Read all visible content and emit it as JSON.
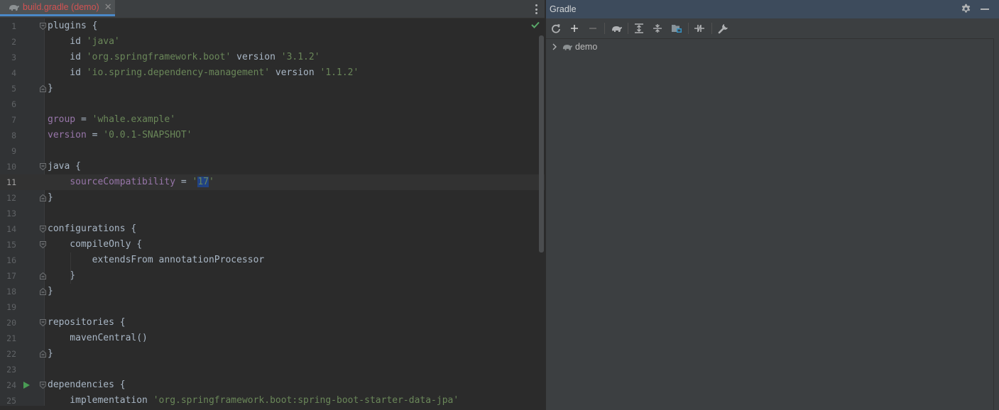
{
  "editor": {
    "tab": {
      "label": "build.gradle (demo)",
      "close": "✕"
    },
    "current_line": 11,
    "lines": [
      {
        "n": "1",
        "tokens": [
          {
            "t": "plugins {",
            "c": "plain"
          }
        ]
      },
      {
        "n": "2",
        "tokens": [
          {
            "t": "    id ",
            "c": "plain"
          },
          {
            "t": "'java'",
            "c": "str"
          }
        ]
      },
      {
        "n": "3",
        "tokens": [
          {
            "t": "    id ",
            "c": "plain"
          },
          {
            "t": "'org.springframework.boot'",
            "c": "str"
          },
          {
            "t": " version ",
            "c": "plain"
          },
          {
            "t": "'3.1.2'",
            "c": "str"
          }
        ]
      },
      {
        "n": "4",
        "tokens": [
          {
            "t": "    id ",
            "c": "plain"
          },
          {
            "t": "'io.spring.dependency-management'",
            "c": "str"
          },
          {
            "t": " version ",
            "c": "plain"
          },
          {
            "t": "'1.1.2'",
            "c": "str"
          }
        ]
      },
      {
        "n": "5",
        "tokens": [
          {
            "t": "}",
            "c": "plain"
          }
        ]
      },
      {
        "n": "6",
        "tokens": []
      },
      {
        "n": "7",
        "tokens": [
          {
            "t": "group",
            "c": "prop"
          },
          {
            "t": " = ",
            "c": "plain"
          },
          {
            "t": "'whale.example'",
            "c": "str"
          }
        ]
      },
      {
        "n": "8",
        "tokens": [
          {
            "t": "version",
            "c": "prop"
          },
          {
            "t": " = ",
            "c": "plain"
          },
          {
            "t": "'0.0.1-SNAPSHOT'",
            "c": "str"
          }
        ]
      },
      {
        "n": "9",
        "tokens": []
      },
      {
        "n": "10",
        "tokens": [
          {
            "t": "java {",
            "c": "plain"
          }
        ]
      },
      {
        "n": "11",
        "tokens": [
          {
            "t": "    ",
            "c": "plain"
          },
          {
            "t": "sourceCompatibility",
            "c": "prop"
          },
          {
            "t": " = ",
            "c": "plain"
          },
          {
            "t": "'",
            "c": "str"
          },
          {
            "t": "17",
            "c": "str-sel"
          },
          {
            "t": "'",
            "c": "str"
          }
        ]
      },
      {
        "n": "12",
        "tokens": [
          {
            "t": "}",
            "c": "plain"
          }
        ]
      },
      {
        "n": "13",
        "tokens": []
      },
      {
        "n": "14",
        "tokens": [
          {
            "t": "configurations {",
            "c": "plain"
          }
        ]
      },
      {
        "n": "15",
        "tokens": [
          {
            "t": "    compileOnly {",
            "c": "plain"
          }
        ]
      },
      {
        "n": "16",
        "tokens": [
          {
            "t": "        extendsFrom annotationProcessor",
            "c": "plain"
          }
        ]
      },
      {
        "n": "17",
        "tokens": [
          {
            "t": "    }",
            "c": "plain"
          }
        ]
      },
      {
        "n": "18",
        "tokens": [
          {
            "t": "}",
            "c": "plain"
          }
        ]
      },
      {
        "n": "19",
        "tokens": []
      },
      {
        "n": "20",
        "tokens": [
          {
            "t": "repositories {",
            "c": "plain"
          }
        ]
      },
      {
        "n": "21",
        "tokens": [
          {
            "t": "    mavenCentral()",
            "c": "plain"
          }
        ]
      },
      {
        "n": "22",
        "tokens": [
          {
            "t": "}",
            "c": "plain"
          }
        ]
      },
      {
        "n": "23",
        "tokens": []
      },
      {
        "n": "24",
        "tokens": [
          {
            "t": "dependencies {",
            "c": "plain"
          }
        ]
      },
      {
        "n": "25",
        "tokens": [
          {
            "t": "    implementation ",
            "c": "plain"
          },
          {
            "t": "'org.springframework.boot:spring-boot-starter-data-jpa'",
            "c": "str"
          }
        ]
      }
    ],
    "fold_open_lines": [
      1,
      10,
      14,
      15,
      20,
      24
    ],
    "fold_close_lines": [
      5,
      12,
      17,
      18,
      22
    ],
    "run_gutter_lines": [
      24
    ]
  },
  "gradle_panel": {
    "title": "Gradle",
    "toolbar": [
      {
        "name": "reload-all-icon"
      },
      {
        "name": "add-icon"
      },
      {
        "name": "remove-icon"
      },
      {
        "name": "execute-gradle-task-icon"
      },
      {
        "name": "expand-all-icon"
      },
      {
        "name": "collapse-all-icon"
      },
      {
        "name": "analyze-dependencies-icon"
      },
      {
        "name": "toggle-offline-mode-icon"
      },
      {
        "name": "build-tool-settings-icon"
      }
    ],
    "tree": [
      {
        "label": "demo",
        "expanded": false
      }
    ]
  },
  "colors": {
    "editor_bg": "#2b2b2b",
    "string": "#6a8759",
    "property": "#9876aa",
    "text": "#a9b7c6",
    "modified_tab": "#d25252",
    "selection": "#214283",
    "panel_header": "#3d4b5c"
  }
}
